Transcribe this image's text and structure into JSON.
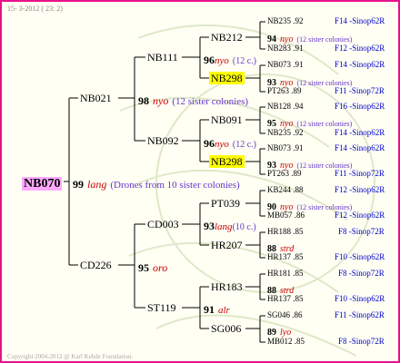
{
  "date": "15- 3-2012 ( 23: 2)",
  "copyright": "Copyright 2004-2012 @ Karl Kehde Foundation.",
  "root": {
    "id": "NB070",
    "score": "99",
    "race": "lang",
    "note": "(Drones from 10 sister colonies)"
  },
  "gen1": [
    {
      "id": "NB021"
    },
    {
      "id": "CD226",
      "score": "95",
      "race": "oro"
    }
  ],
  "gen2": [
    {
      "id": "NB111",
      "score": "98",
      "race": "nyo",
      "note": "(12 sister colonies)"
    },
    {
      "id": "NB092"
    },
    {
      "id": "CD003",
      "score": "93",
      "race": "lang",
      "note": "(10 c.)"
    },
    {
      "id": "ST119",
      "score": "91",
      "race": "alr"
    }
  ],
  "gen3": [
    {
      "id": "NB212",
      "score": "96",
      "race": "nyo",
      "note": "(12 c.)"
    },
    {
      "id": "NB298"
    },
    {
      "id": "NB091",
      "score": "96",
      "race": "nyo",
      "note": "(12 c.)"
    },
    {
      "id": "NB298"
    },
    {
      "id": "PT039"
    },
    {
      "id": "HR207"
    },
    {
      "id": "HR183"
    },
    {
      "id": "SG006"
    }
  ],
  "gen4": [
    {
      "top": "NB235 .92",
      "top_code": "F14 -Sinop62R",
      "score": "94",
      "race": "nyo",
      "note": "(12 sister colonies)",
      "bot": "NB283 .91",
      "bot_code": "F12 -Sinop62R"
    },
    {
      "top": "NB073 .91",
      "top_code": "F14 -Sinop62R",
      "score": "93",
      "race": "nyo",
      "note": "(12 sister colonies)",
      "bot": "PT263 .89",
      "bot_code": "F11 -Sinop72R"
    },
    {
      "top": "NB128 .94",
      "top_code": "F16 -Sinop62R",
      "score": "95",
      "race": "nyo",
      "note": "(12 sister colonies)",
      "bot": "NB235 .92",
      "bot_code": "F14 -Sinop62R"
    },
    {
      "top": "NB073 .91",
      "top_code": "F14 -Sinop62R",
      "score": "93",
      "race": "nyo",
      "note": "(12 sister colonies)",
      "bot": "PT263 .89",
      "bot_code": "F11 -Sinop72R"
    },
    {
      "top": "KB244 .88",
      "top_code": "F12 -Sinop62R",
      "score": "90",
      "race": "nyo",
      "note": "(12 sister colonies)",
      "bot": "MB057 .86",
      "bot_code": "F12 -Sinop62R"
    },
    {
      "top": "HR188 .85",
      "top_code": "F8 -Sinop72R",
      "score": "88",
      "race": "strd",
      "note": "",
      "bot": "HR137 .85",
      "bot_code": "F10 -Sinop62R"
    },
    {
      "top": "HR181 .85",
      "top_code": "F8 -Sinop72R",
      "score": "88",
      "race": "strd",
      "note": "",
      "bot": "HR137 .85",
      "bot_code": "F10 -Sinop62R"
    },
    {
      "top": "SG046 .86",
      "top_code": "F11 -Sinop62R",
      "score": "89",
      "race": "lyo",
      "note": "",
      "bot": "MB012 .85",
      "bot_code": "F8 -Sinop72R"
    }
  ]
}
